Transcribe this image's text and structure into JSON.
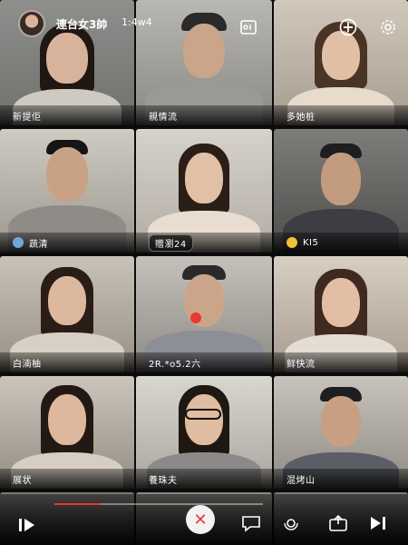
{
  "header": {
    "title": "連台女3帥",
    "subtitle": "1:4w4",
    "icons": {
      "avatar": "avatar",
      "screen": "screen-share-icon",
      "add": "add-icon",
      "settings": "gear-icon"
    }
  },
  "participants": [
    {
      "name": "新提佢",
      "badge": null
    },
    {
      "name": "親情流",
      "badge": null
    },
    {
      "name": "多她桩",
      "badge": null
    },
    {
      "name": "蔬清",
      "badge": "#6fa8dc"
    },
    {
      "name": "贈瀏24",
      "badge": null,
      "pill": true
    },
    {
      "name": "KI5",
      "badge": "#f1c232"
    },
    {
      "name": "白湳柚",
      "badge": null
    },
    {
      "name": "2R.*o5.2六",
      "badge": null
    },
    {
      "name": "鲜快流",
      "badge": null
    },
    {
      "name": "展状",
      "badge": null
    },
    {
      "name": "養珠夫",
      "badge": null
    },
    {
      "name": "混烤山",
      "badge": null
    }
  ],
  "controls": {
    "progress": 0.22,
    "icons": [
      "play-pause-icon",
      "end-call-icon",
      "chat-icon",
      "mic-icon",
      "share-icon",
      "next-icon"
    ],
    "end_symbol": "✕"
  },
  "colors": {
    "accent": "#e53935",
    "background": "#0b0b0c"
  }
}
